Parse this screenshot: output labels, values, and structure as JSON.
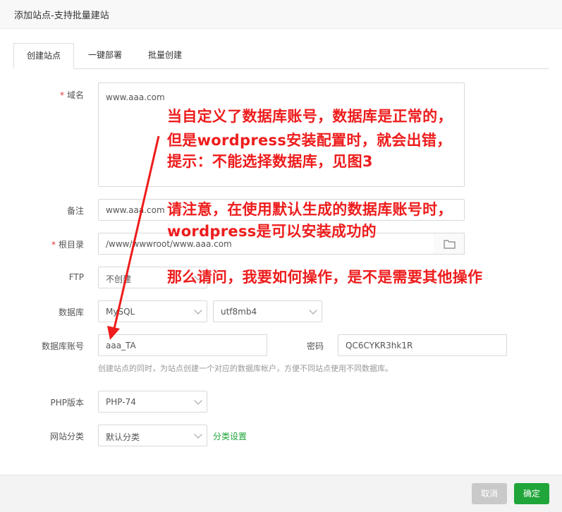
{
  "dialog": {
    "title": "添加站点-支持批量建站"
  },
  "tabs": [
    {
      "label": "创建站点",
      "active": true
    },
    {
      "label": "一键部署",
      "active": false
    },
    {
      "label": "批量创建",
      "active": false
    }
  ],
  "form": {
    "domain": {
      "label": "域名",
      "required": "*",
      "value": "www.aaa.com"
    },
    "remark": {
      "label": "备注",
      "value": "www.aaa.com"
    },
    "root": {
      "label": "根目录",
      "required": "*",
      "value": "/www/wwwroot/www.aaa.com"
    },
    "ftp": {
      "label": "FTP",
      "value": "不创建"
    },
    "database": {
      "label": "数据库",
      "type_value": "MySQL",
      "charset_value": "utf8mb4"
    },
    "db_account": {
      "label": "数据库账号",
      "value": "aaa_TA",
      "password_label": "密码",
      "password_value": "QC6CYKR3hk1R"
    },
    "db_hint": "创建站点的同时，为站点创建一个对应的数据库帐户，方便不同站点使用不同数据库。",
    "php": {
      "label": "PHP版本",
      "value": "PHP-74"
    },
    "category": {
      "label": "网站分类",
      "value": "默认分类",
      "link": "分类设置"
    }
  },
  "footer": {
    "cancel_label": "取消",
    "confirm_label": "确定"
  },
  "annotations": {
    "line1": "当自定义了数据库账号，数据库是正常的，",
    "line2": "但是wordpress安装配置时，就会出错，",
    "line3": "提示：不能选择数据库，见图3",
    "line4": "请注意，在使用默认生成的数据库账号时，",
    "line5": "wordpress是可以安装成功的",
    "line6": "那么请问，我要如何操作，是不是需要其他操作"
  },
  "colors": {
    "accent": "#20a53a",
    "annotation": "#ee1c1c",
    "required": "#e53935"
  }
}
